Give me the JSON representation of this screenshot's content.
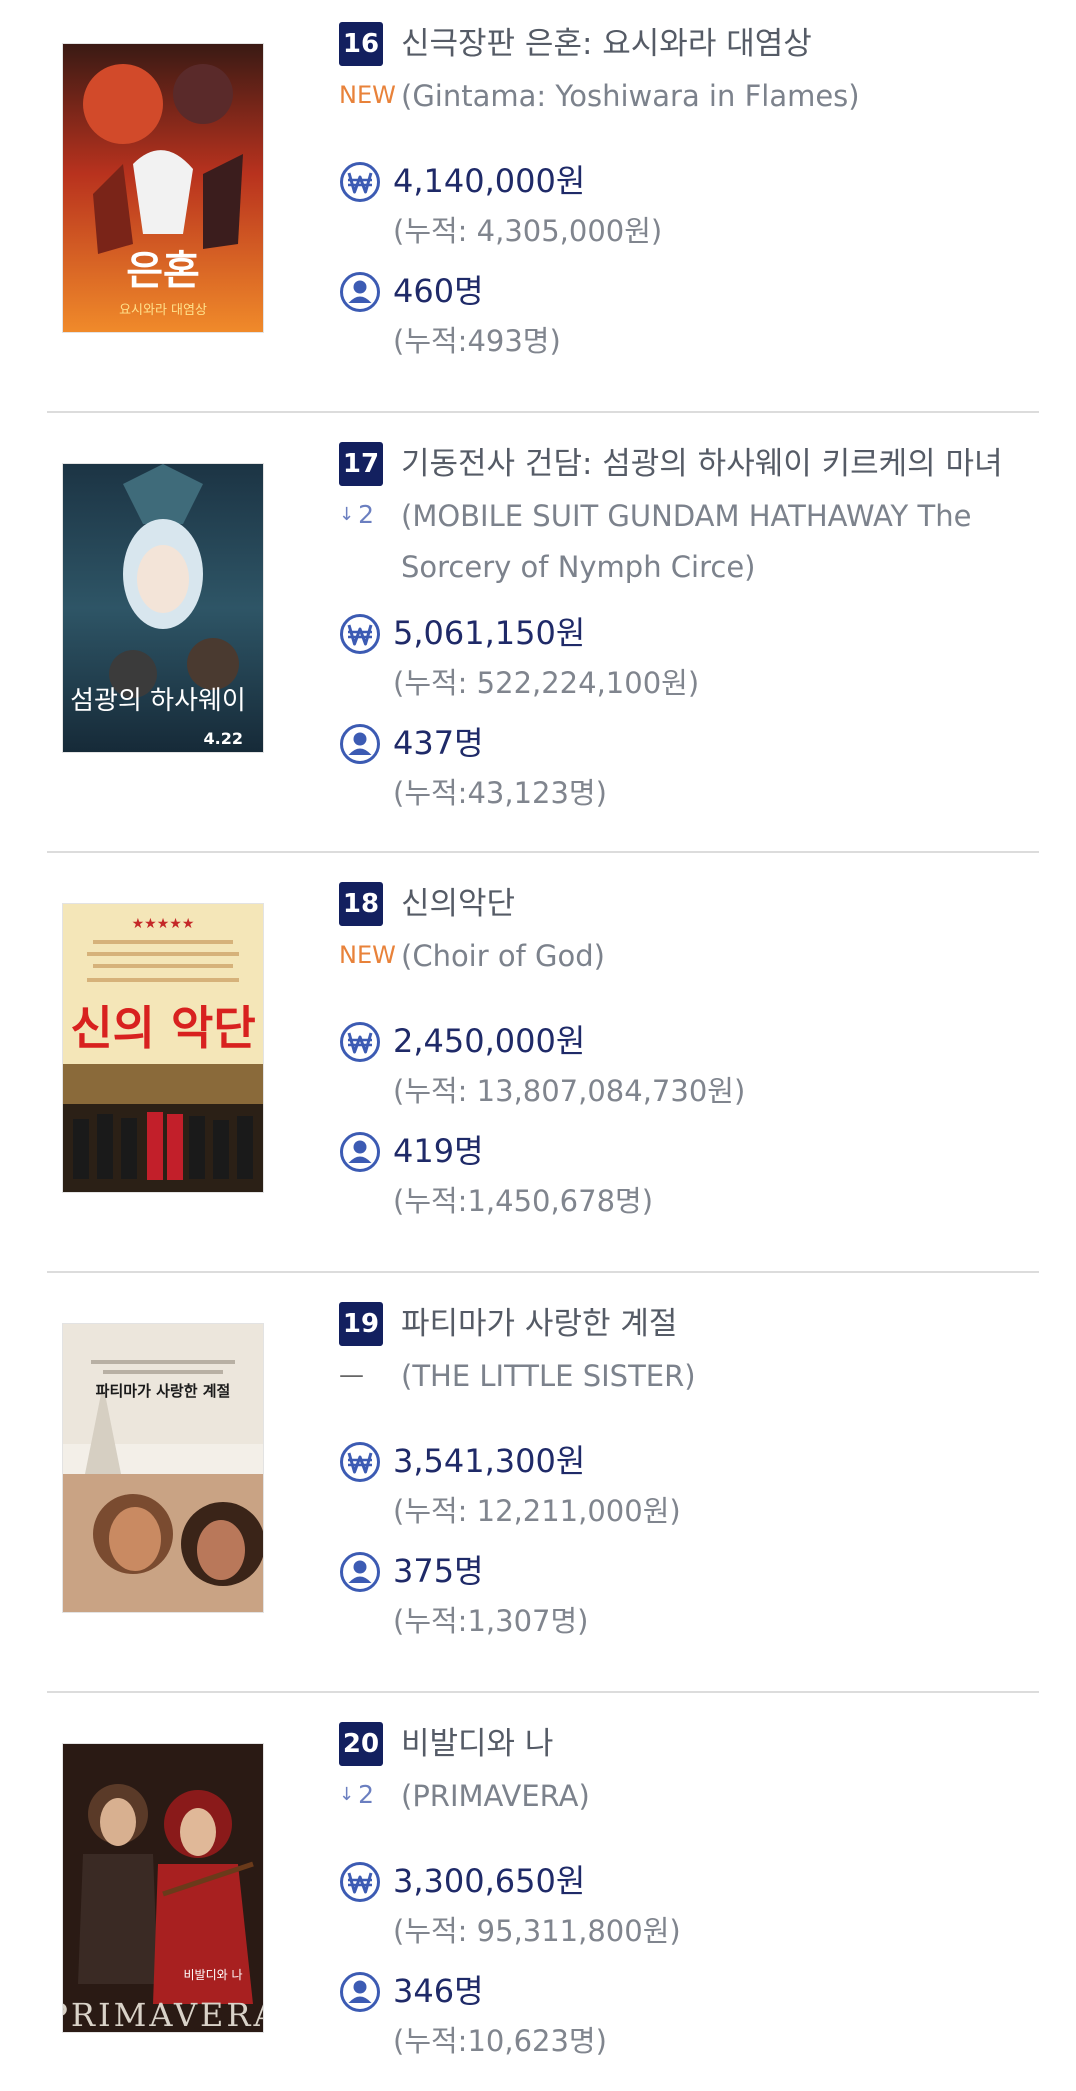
{
  "movies": [
    {
      "rank": "16",
      "title_ko": "신극장판 은혼: 요시와라 대염상",
      "change": "NEW",
      "title_en": "(Gintama: Yoshiwara in Flames)",
      "sales": "4,140,000원",
      "sales_total": "(누적: 4,305,000원)",
      "audience": "460명",
      "audience_total": "(누적:493명)",
      "poster_text": "은혼",
      "poster_caption": "요시와라 대염상"
    },
    {
      "rank": "17",
      "title_ko": "기동전사 건담: 섬광의 하사웨이 키르케의 마녀",
      "change_num": "2",
      "title_en": "(MOBILE SUIT GUNDAM HATHAWAY The Sorcery of Nymph Circe)",
      "sales": "5,061,150원",
      "sales_total": "(누적: 522,224,100원)",
      "audience": "437명",
      "audience_total": "(누적:43,123명)",
      "poster_text": "섬광의 하사웨이",
      "poster_date": "4.22"
    },
    {
      "rank": "18",
      "title_ko": "신의악단",
      "change": "NEW",
      "title_en": "(Choir of God)",
      "sales": "2,450,000원",
      "sales_total": "(누적: 13,807,084,730원)",
      "audience": "419명",
      "audience_total": "(누적:1,450,678명)",
      "poster_text": "신의 악단",
      "poster_stars": "★★★★★"
    },
    {
      "rank": "19",
      "title_ko": "파티마가 사랑한 계절",
      "change": "—",
      "title_en": "(THE LITTLE SISTER)",
      "sales": "3,541,300원",
      "sales_total": "(누적: 12,211,000원)",
      "audience": "375명",
      "audience_total": "(누적:1,307명)",
      "poster_text": "파티마가 사랑한 계절"
    },
    {
      "rank": "20",
      "title_ko": "비발디와 나",
      "change_num": "2",
      "title_en": "(PRIMAVERA)",
      "sales": "3,300,650원",
      "sales_total": "(누적: 95,311,800원)",
      "audience": "346명",
      "audience_total": "(누적:10,623명)",
      "poster_text": "PRIMAVERA",
      "poster_caption": "비발디와 나"
    }
  ],
  "icons": {
    "won": "won-icon",
    "person": "person-icon"
  },
  "colors": {
    "badge": "#13205f",
    "new": "#e8823a",
    "down": "#6b7fc0",
    "icon": "#3c5bb3"
  }
}
